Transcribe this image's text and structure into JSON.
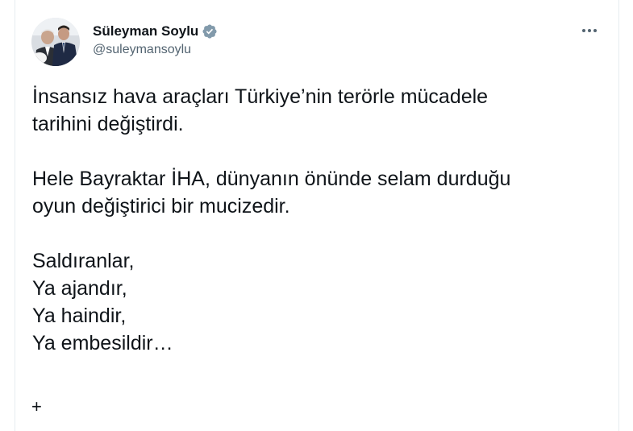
{
  "tweet": {
    "author": {
      "display_name": "Süleyman Soylu",
      "handle": "@suleymansoylu",
      "verified": true,
      "avatar": "profile-photo"
    },
    "more_icon": "more-options-icon",
    "paragraphs": [
      "İnsansız hava araçları Türkiye’nin terörle mücadele\ntarihini değiştirdi.",
      "Hele Bayraktar İHA, dünyanın önünde selam durduğu\noyun değiştirici bir mucizedir.",
      "Saldıranlar,\nYa ajandır,\nYa haindir,\nYa embesildir…"
    ],
    "footer_symbol": "+"
  },
  "colors": {
    "text": "#0f1419",
    "secondary_text": "#536471",
    "verified_badge": "#829aab",
    "border": "#e6ecf0"
  }
}
